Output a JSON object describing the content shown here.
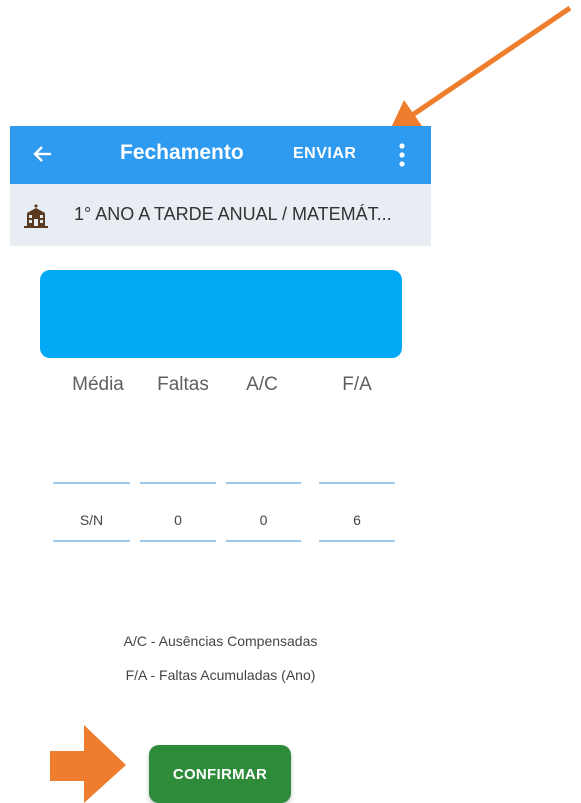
{
  "appbar": {
    "title": "Fechamento",
    "send_label": "ENVIAR",
    "back_icon": "arrow-left",
    "menu_icon": "more-vertical"
  },
  "classbar": {
    "icon": "school-building",
    "class_name": "1° ANO A TARDE ANUAL / MATEMÁT..."
  },
  "columns": [
    "Média",
    "Faltas",
    "A/C",
    "F/A"
  ],
  "values": [
    "S/N",
    "0",
    "0",
    "6"
  ],
  "legend": {
    "ac": "A/C - Ausências Compensadas",
    "fa": "F/A - Faltas Acumuladas (Ano)"
  },
  "confirm_label": "CONFIRMAR",
  "colors": {
    "appbar": "#2e9bf0",
    "banner": "#03a8f4",
    "confirm": "#2e8b3a",
    "annotation_arrow": "#ef7d2e"
  }
}
